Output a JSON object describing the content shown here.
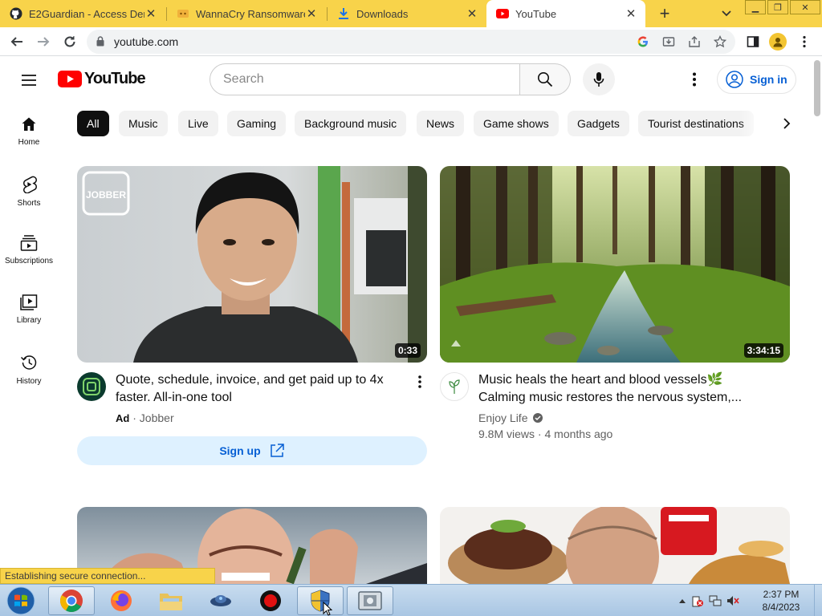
{
  "browser": {
    "tabs": [
      {
        "title": "E2Guardian - Access Den",
        "icon": "github-icon",
        "active": false
      },
      {
        "title": "WannaCry Ransomware V",
        "icon": "cry-icon",
        "active": false
      },
      {
        "title": "Downloads",
        "icon": "download-icon",
        "active": false
      },
      {
        "title": "YouTube",
        "icon": "youtube-icon",
        "active": true
      }
    ],
    "new_tab": "+",
    "url": "youtube.com",
    "status_text": "Establishing secure connection..."
  },
  "youtube": {
    "logo_text": "YouTube",
    "search_placeholder": "Search",
    "sign_in": "Sign in",
    "nav": [
      {
        "label": "Home",
        "icon": "home-icon"
      },
      {
        "label": "Shorts",
        "icon": "shorts-icon"
      },
      {
        "label": "Subscriptions",
        "icon": "subscriptions-icon"
      },
      {
        "label": "Library",
        "icon": "library-icon"
      },
      {
        "label": "History",
        "icon": "history-icon"
      }
    ],
    "chips": [
      "All",
      "Music",
      "Live",
      "Gaming",
      "Background music",
      "News",
      "Game shows",
      "Gadgets",
      "Tourist destinations"
    ],
    "videos": [
      {
        "title_line1": "Quote, schedule, invoice, and get paid up to 4x",
        "title_line2": "faster. All-in-one tool",
        "ad_badge": "Ad",
        "separator": "·",
        "channel": "Jobber",
        "duration": "0:33",
        "cta": "Sign up",
        "thumb_watermark": "JOBBER"
      },
      {
        "title_line1": "Music heals the heart and blood vessels🌿",
        "title_line2": "Calming music restores the nervous system,...",
        "channel": "Enjoy Life",
        "views": "9.8M views",
        "separator": "·",
        "age": "4 months ago",
        "duration": "3:34:15"
      }
    ],
    "colors": {
      "brand_red": "#ff0000",
      "link_blue": "#065fd4",
      "chrome_yellow": "#f8d34a"
    }
  },
  "taskbar": {
    "time": "2:37 PM",
    "date": "8/4/2023"
  }
}
